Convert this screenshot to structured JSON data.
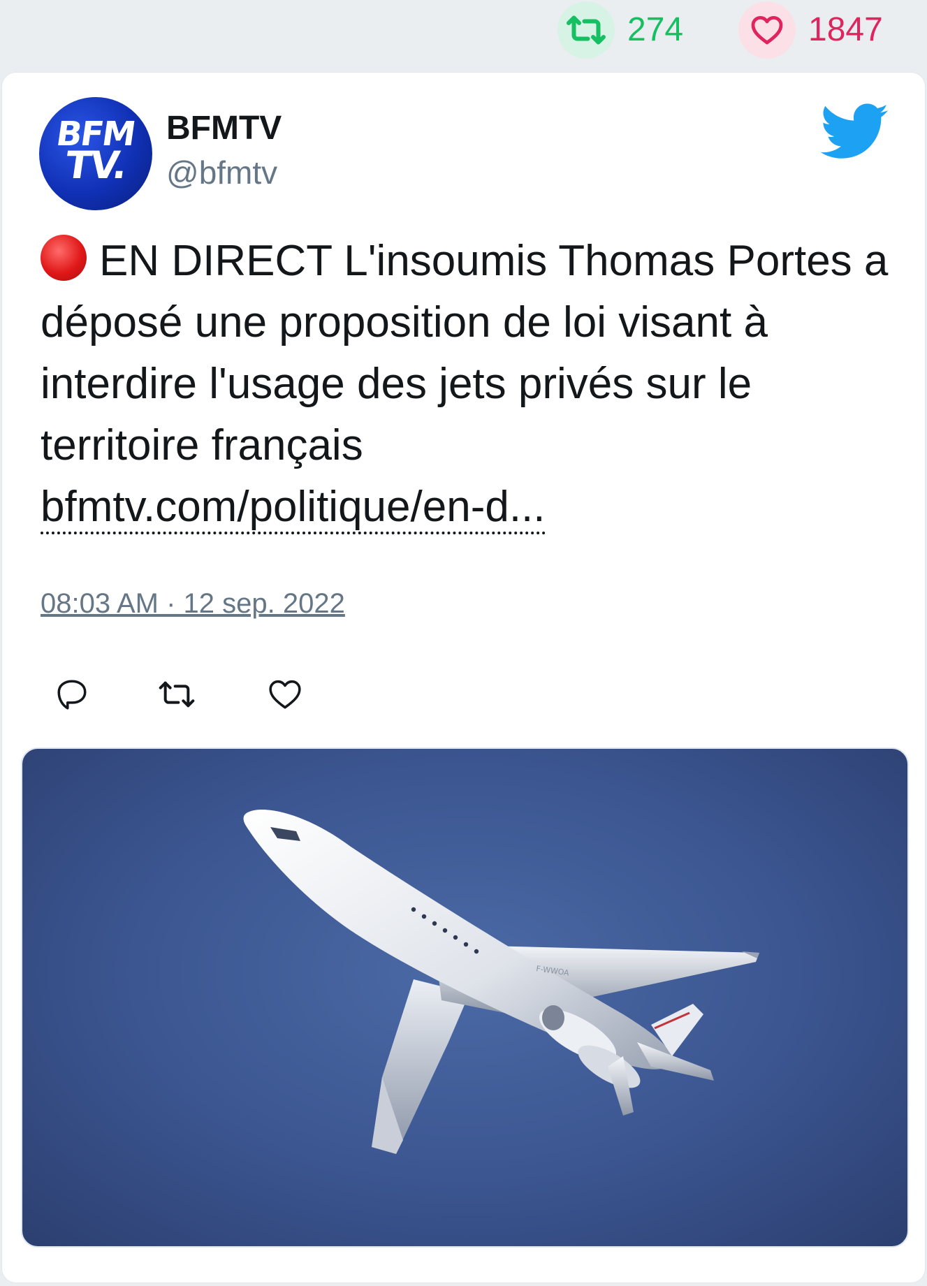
{
  "stats": {
    "retweets": "274",
    "likes": "1847",
    "retweet_icon": "retweet-icon",
    "like_icon": "heart-icon",
    "retweet_color": "#17bf63",
    "like_color": "#e0245e"
  },
  "tweet": {
    "author": {
      "name": "BFMTV",
      "handle": "@bfmtv",
      "avatar_line1": "BFM",
      "avatar_line2": "TV.",
      "avatar_color": "#1030b5"
    },
    "platform_icon": "twitter-bird-icon",
    "platform_color": "#1da1f2",
    "live_icon": "red-circle-icon",
    "text": "EN DIRECT L'insoumis Thomas Portes a déposé une proposition de loi visant à interdire l'usage des jets privés sur le territoire français",
    "link": "bfmtv.com/politique/en-d...",
    "timestamp": "08:03 AM · 12 sep. 2022",
    "actions": [
      {
        "name": "reply",
        "icon": "reply-icon"
      },
      {
        "name": "retweet",
        "icon": "retweet-icon"
      },
      {
        "name": "like",
        "icon": "heart-icon"
      }
    ],
    "media": {
      "description_icon": "private-jet-photo",
      "registration": "F-WWOA",
      "sky_color": "#3b5590"
    }
  }
}
